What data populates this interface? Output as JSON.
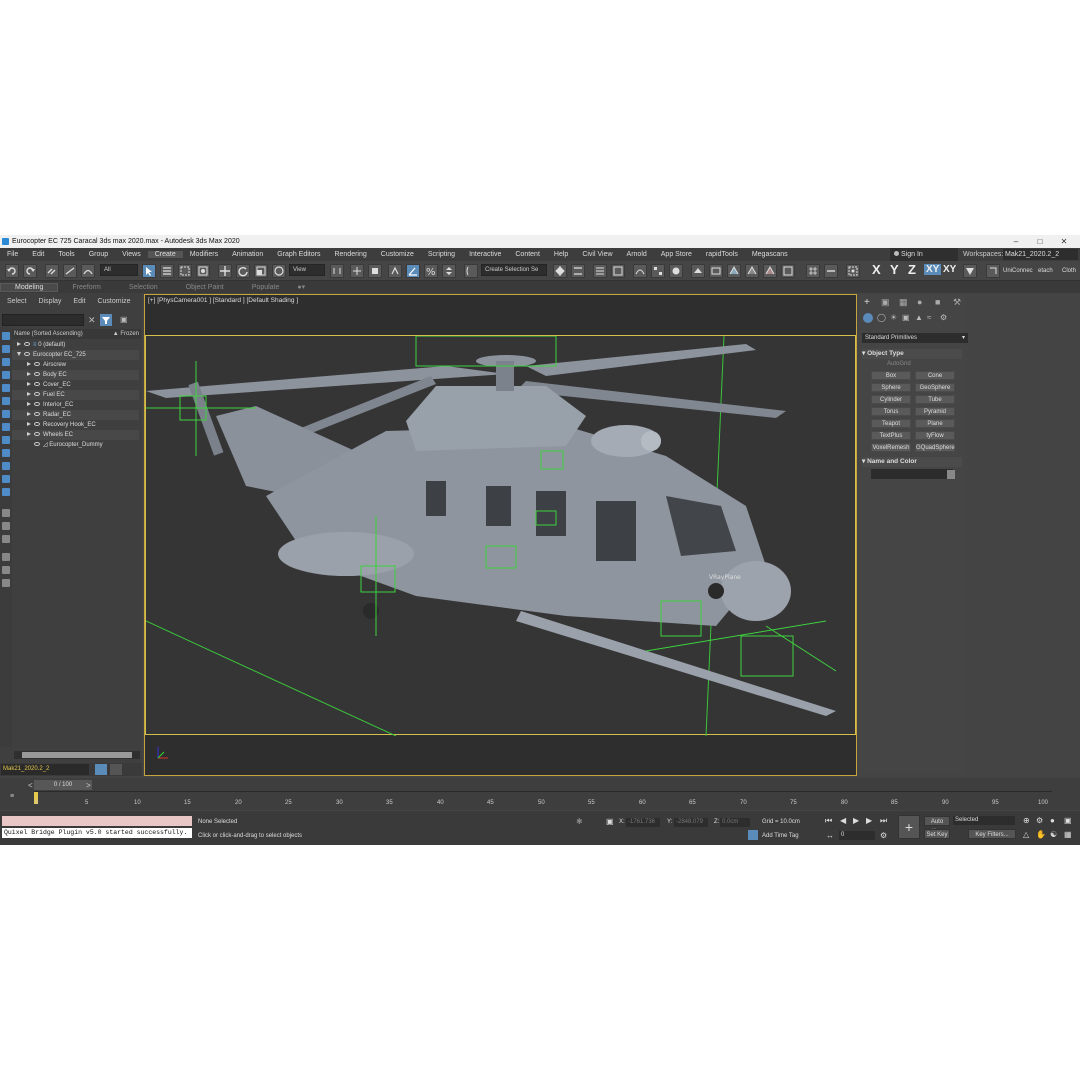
{
  "window": {
    "title": "Eurocopter EC 725 Caracal 3ds max 2020.max - Autodesk 3ds Max 2020"
  },
  "menu": [
    "File",
    "Edit",
    "Tools",
    "Group",
    "Views",
    "Create",
    "Modifiers",
    "Animation",
    "Graph Editors",
    "Rendering",
    "Customize",
    "Scripting",
    "Interactive",
    "Content",
    "Help",
    "Civil View",
    "Arnold",
    "App Store",
    "rapidTools",
    "Megascans"
  ],
  "account": {
    "sign_in": "Sign In",
    "workspaces_label": "Workspaces:",
    "workspace": "Mak21_2020.2_2"
  },
  "toolbar": {
    "selection_filter": "All",
    "ref_coord": "View",
    "selection_set": "Create Selection Se",
    "axis_x": "X",
    "axis_y": "Y",
    "axis_z": "Z",
    "axis_xy": "XY",
    "axis_xy2": "XY",
    "uniconnect": "UniConnec",
    "detach": "etach",
    "cloth": "Cloth"
  },
  "ribbon": {
    "tabs": [
      "Modeling",
      "Freeform",
      "Selection",
      "Object Paint",
      "Populate"
    ]
  },
  "scene_explorer": {
    "menu": [
      "Select",
      "Display",
      "Edit",
      "Customize"
    ],
    "col_name": "Name (Sorted Ascending)",
    "col_frozen": "▲ Frozen",
    "rows": [
      {
        "name": "0 (default)"
      },
      {
        "name": "Eurocopter EC_725"
      },
      {
        "name": "Airscrew"
      },
      {
        "name": "Body EC"
      },
      {
        "name": "Cover_EC"
      },
      {
        "name": "Fuel EC"
      },
      {
        "name": "Interior_EC"
      },
      {
        "name": "Radar_EC"
      },
      {
        "name": "Recovery Hook_EC"
      },
      {
        "name": "Wheels EC"
      },
      {
        "name": "Eurocopter_Dummy"
      }
    ],
    "layer": "Mak21_2020.2_2"
  },
  "viewport": {
    "label": "[+] [PhysCamera001 ] [Standard ] [Default Shading ]",
    "vray_label": "VRayPlane"
  },
  "command_panel": {
    "category": "Standard Primitives",
    "object_type_title": "Object Type",
    "autogrid": "AutoGrid",
    "buttons": [
      "Box",
      "Cone",
      "Sphere",
      "GeoSphere",
      "Cylinder",
      "Tube",
      "Torus",
      "Pyramid",
      "Teapot",
      "Plane",
      "TextPlus",
      "tyFlow",
      "VoxelRemesh",
      "GQuadSphere"
    ],
    "name_color_title": "Name and Color"
  },
  "timeline": {
    "slider": "0 / 100",
    "ticks": [
      "0",
      "5",
      "10",
      "15",
      "20",
      "25",
      "30",
      "35",
      "40",
      "45",
      "50",
      "55",
      "60",
      "65",
      "70",
      "75",
      "80",
      "85",
      "90",
      "95",
      "100"
    ]
  },
  "status": {
    "message": "Quixel Bridge Plugin v5.0 started successfully.",
    "selection": "None Selected",
    "prompt": "Click or click-and-drag to select objects",
    "x_label": "X:",
    "x_value": "-1761.736",
    "y_label": "Y:",
    "y_value": "-2848.079",
    "z_label": "Z:",
    "z_value": "0.0cm",
    "grid": "Grid = 10.0cm",
    "add_time_tag": "Add Time Tag",
    "auto_key": "Auto Key",
    "selected": "Selected",
    "set_key": "Set Key",
    "key_filters": "Key Filters...",
    "frame": "0"
  }
}
